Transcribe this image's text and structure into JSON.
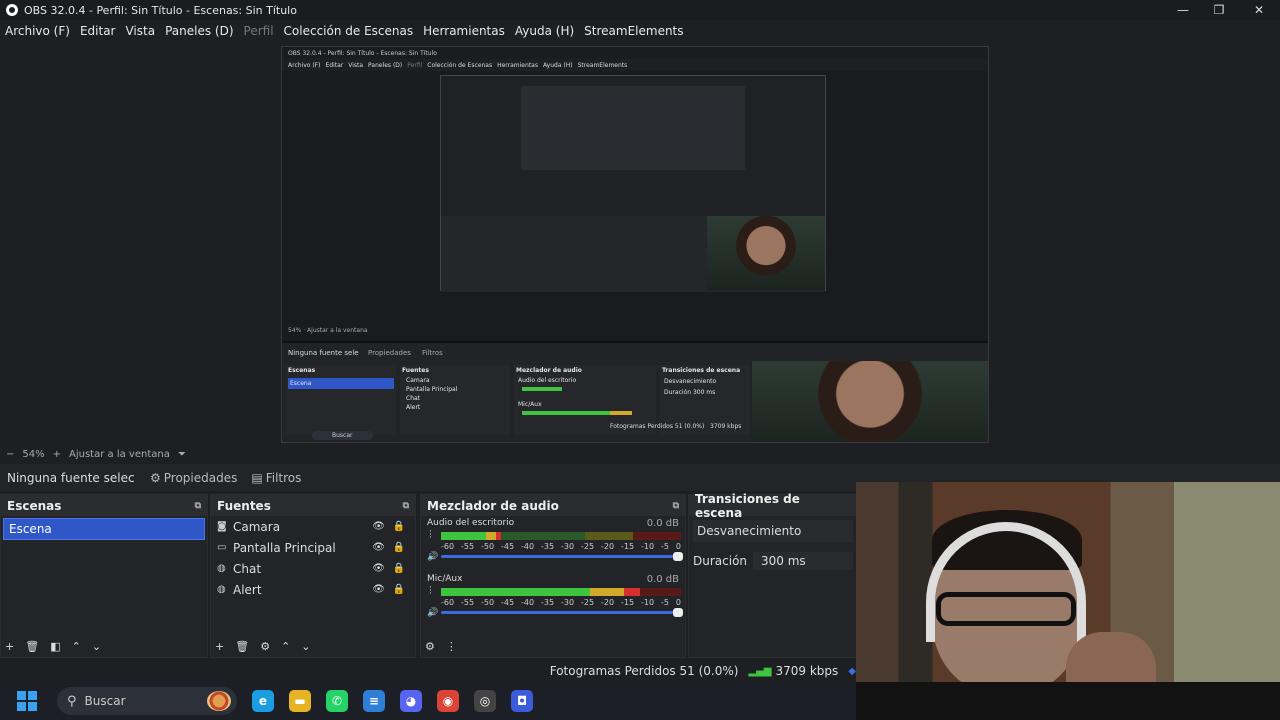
{
  "window": {
    "title": "OBS 32.0.4 - Perfil: Sin Título - Escenas: Sin Título",
    "minimize": "—",
    "maximize": "❐",
    "close": "✕"
  },
  "menu": [
    {
      "label": "Archivo (F)",
      "enabled": true
    },
    {
      "label": "Editar",
      "enabled": true
    },
    {
      "label": "Vista",
      "enabled": true
    },
    {
      "label": "Paneles (D)",
      "enabled": true
    },
    {
      "label": "Perfil",
      "enabled": false
    },
    {
      "label": "Colección de Escenas",
      "enabled": true
    },
    {
      "label": "Herramientas",
      "enabled": true
    },
    {
      "label": "Ayuda (H)",
      "enabled": true
    },
    {
      "label": "StreamElements",
      "enabled": true
    }
  ],
  "inner": {
    "title": "OBS 32.0.4 - Perfil: Sin Título - Escenas: Sin Título",
    "menu": [
      "Archivo (F)",
      "Editar",
      "Vista",
      "Paneles (D)",
      "Perfil",
      "Colección de Escenas",
      "Herramientas",
      "Ayuda (H)",
      "StreamElements"
    ],
    "zoom_bar": "54%   ·   Ajustar a la ventana",
    "no_source": "Ninguna fuente sele",
    "props": "Propiedades",
    "filters": "Filtros",
    "scenes_title": "Escenas",
    "scene": "Escena",
    "sources_title": "Fuentes",
    "sources": [
      "Camara",
      "Pantalla Principal",
      "Chat",
      "Alert"
    ],
    "mixer_title": "Mezclador de audio",
    "ch1": "Audio del escritorio",
    "ch2": "Mic/Aux",
    "trans_title": "Transiciones de escena",
    "trans": "Desvanecimiento",
    "dur_label": "Duración",
    "dur": "300 ms",
    "status": "Fotogramas Perdidos 51 (0.0%)",
    "kbps": "3709 kbps",
    "search": "Buscar"
  },
  "preview_toolbar": {
    "minus": "−",
    "zoom": "54%",
    "plus": "+",
    "fit": "Ajustar a la ventana",
    "caret": "⏷"
  },
  "source_bar": {
    "no_source": "Ninguna fuente selec",
    "properties": "Propiedades",
    "filters": "Filtros"
  },
  "scenes": {
    "title": "Escenas",
    "items": [
      "Escena"
    ]
  },
  "sources": {
    "title": "Fuentes",
    "items": [
      {
        "label": "Camara",
        "icon": "camera-icon",
        "glyph": "◙"
      },
      {
        "label": "Pantalla Principal",
        "icon": "monitor-icon",
        "glyph": "▭"
      },
      {
        "label": "Chat",
        "icon": "globe-icon",
        "glyph": "◍"
      },
      {
        "label": "Alert",
        "icon": "globe-icon",
        "glyph": "◍"
      }
    ]
  },
  "mixer": {
    "title": "Mezclador de audio",
    "channels": [
      {
        "name": "Audio del escritorio",
        "db": "0.0 dB",
        "level": 0.25
      },
      {
        "name": "Mic/Aux",
        "db": "0.0 dB",
        "level": 0.83
      }
    ],
    "scale": [
      "-60",
      "-55",
      "-50",
      "-45",
      "-40",
      "-35",
      "-30",
      "-25",
      "-20",
      "-15",
      "-10",
      "-5",
      "0"
    ]
  },
  "transitions": {
    "title": "Transiciones de escena",
    "selected": "Desvanecimiento",
    "duration_label": "Duración",
    "duration": "300 ms"
  },
  "status": {
    "dropped": "Fotogramas Perdidos 51 (0.0%)",
    "kbps": "3709 kbps"
  },
  "taskbar": {
    "search": "Buscar",
    "apps": [
      {
        "name": "edge-icon",
        "color": "#1b9de2",
        "glyph": "e"
      },
      {
        "name": "folder-icon",
        "color": "#e6b422",
        "glyph": "▬"
      },
      {
        "name": "whatsapp-icon",
        "color": "#25d366",
        "glyph": "✆"
      },
      {
        "name": "notepad-icon",
        "color": "#2f7fd8",
        "glyph": "≡"
      },
      {
        "name": "discord-icon",
        "color": "#5865f2",
        "glyph": "◕"
      },
      {
        "name": "chrome-icon",
        "color": "#db4437",
        "glyph": "◉"
      },
      {
        "name": "obs-icon",
        "color": "#444",
        "glyph": "◎"
      },
      {
        "name": "app-icon",
        "color": "#3b5bdb",
        "glyph": "◘"
      }
    ]
  },
  "colors": {
    "accent": "#2f57c8",
    "meter_green": "#3ec43e",
    "meter_yellow": "#d4a82a",
    "meter_red": "#d43030"
  }
}
